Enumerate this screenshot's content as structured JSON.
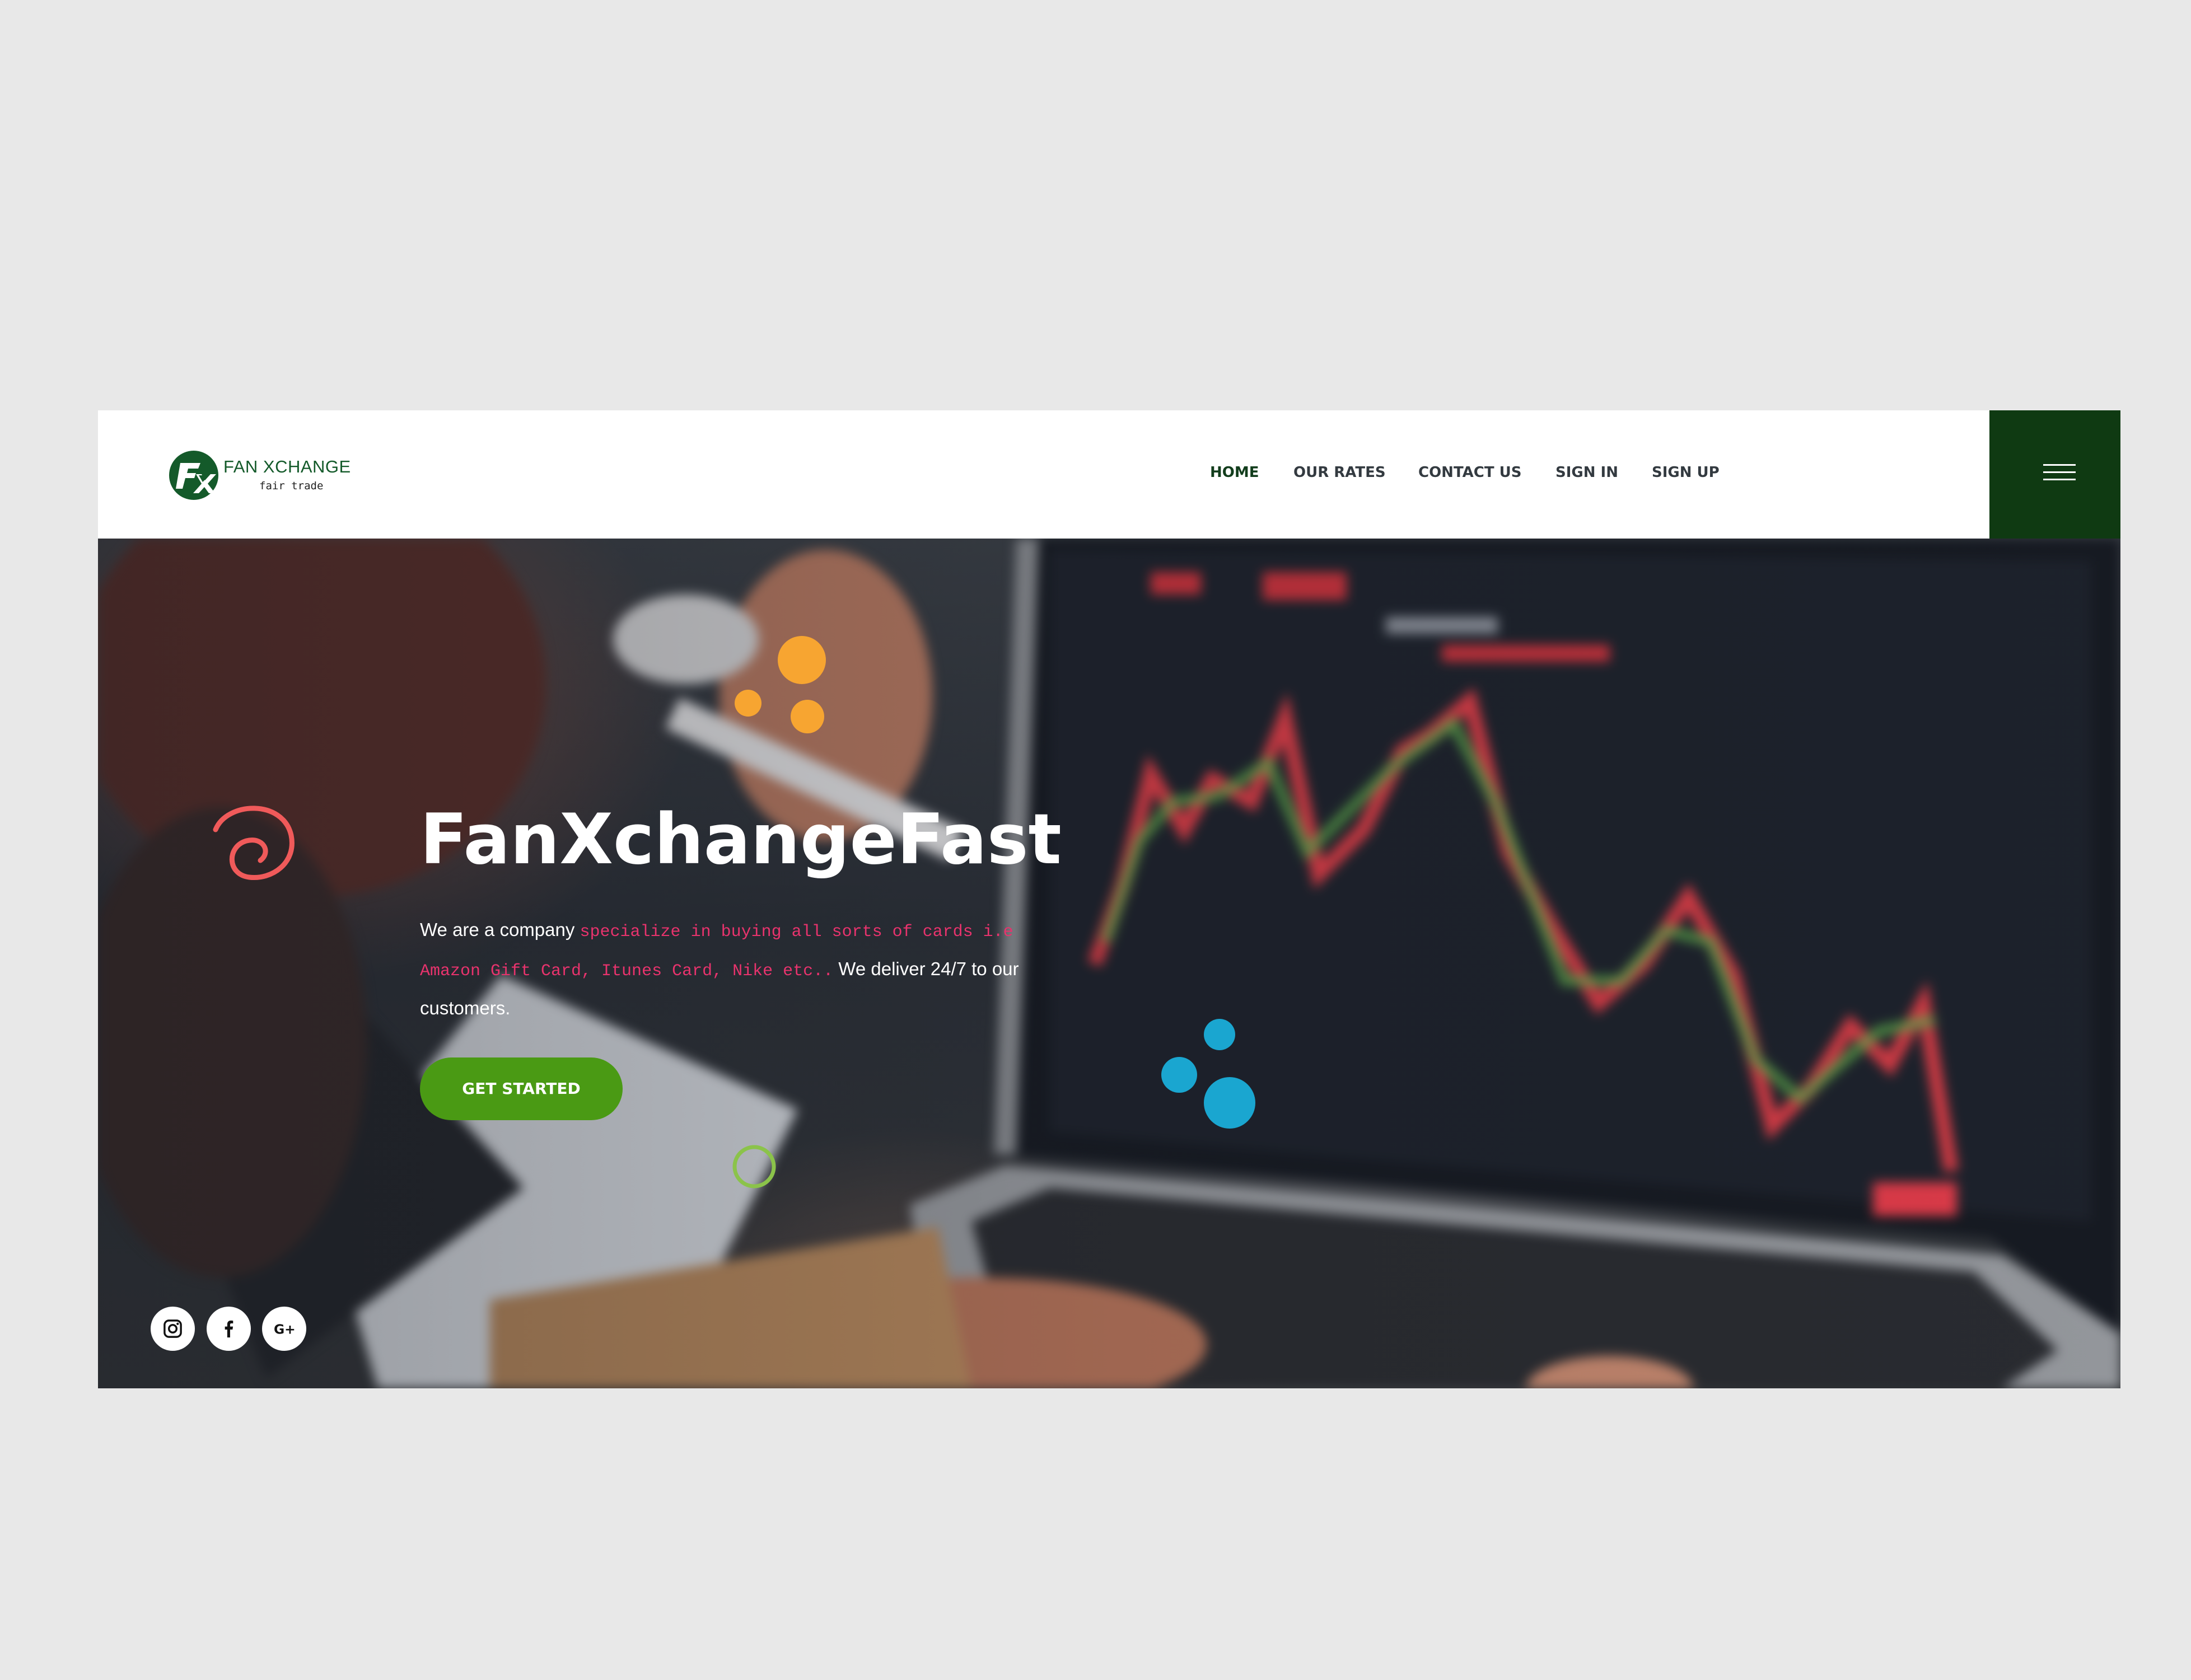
{
  "brand": {
    "name": "FAN XCHANGE",
    "tagline": "fair trade",
    "logo_initials": "FX",
    "primary_color": "#0f3a12",
    "accent_green": "#4a9a14"
  },
  "nav": {
    "items": [
      {
        "label": "HOME",
        "active": true
      },
      {
        "label": "OUR RATES",
        "active": false
      },
      {
        "label": "CONTACT US",
        "active": false
      },
      {
        "label": "SIGN IN",
        "active": false
      },
      {
        "label": "SIGN UP",
        "active": false
      }
    ],
    "menu_icon": "hamburger-menu-icon"
  },
  "hero": {
    "title": "FanXchangeFast",
    "description_intro": "We are a company ",
    "description_highlight": "specialize in buying all sorts of cards i.e Amazon Gift Card, Itunes Card, Nike etc..",
    "description_outro": " We deliver 24/7 to our customers.",
    "highlight_color": "#e8336d",
    "cta_label": "GET STARTED",
    "decor_colors": {
      "swirl": "#f05a5a",
      "orange_dots": "#f7a531",
      "blue_dots": "#1aa6d0",
      "green_ring": "#8bc34a"
    }
  },
  "social": [
    {
      "name": "instagram",
      "icon": "instagram-icon"
    },
    {
      "name": "facebook",
      "icon": "facebook-icon"
    },
    {
      "name": "google-plus",
      "icon": "google-plus-icon"
    }
  ]
}
